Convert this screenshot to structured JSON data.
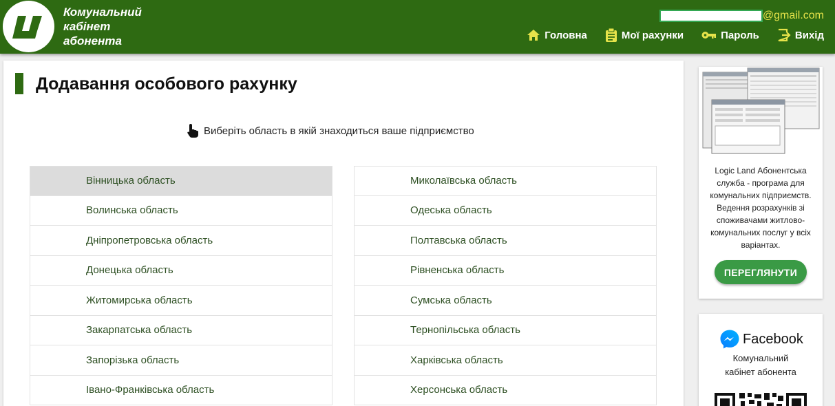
{
  "header": {
    "brand_line1": "Комунальний",
    "brand_line2": "кабінет",
    "brand_line3": "абонента",
    "email_domain": "@gmail.com",
    "nav": {
      "home": "Головна",
      "accounts": "Мої рахунки",
      "password": "Пароль",
      "logout": "Вихід"
    }
  },
  "main": {
    "title": "Додавання особового рахунку",
    "hint": "Виберіть область в якій знаходиться ваше підприємство",
    "regions_left": [
      "Вінницька область",
      "Волинська область",
      "Дніпропетровська область",
      "Донецька область",
      "Житомирська область",
      "Закарпатська область",
      "Запорізька область",
      "Івано-Франківська область"
    ],
    "regions_right": [
      "Миколаївська область",
      "Одеська область",
      "Полтавська область",
      "Рівненська область",
      "Сумська область",
      "Тернопільська область",
      "Харківська область",
      "Херсонська область"
    ]
  },
  "sidebar": {
    "ad_text": "Logic Land Абонентська служба - програма для комунальних підприємств. Ведення розрахунків зі споживачами житлово-комунальних послуг у всіх варіантах.",
    "ad_button": "ПЕРЕГЛЯНУТИ",
    "facebook_title": "Facebook",
    "facebook_sub_line1": "Комунальний",
    "facebook_sub_line2": "кабінет абонента"
  },
  "colors": {
    "header_green": "#2e6a12",
    "email_yellow": "#e6e34a",
    "button_green": "#3a9a45",
    "region_text": "#2d4f22",
    "active_row": "#dcdcdc"
  },
  "icons": [
    "home-icon",
    "clipboard-icon",
    "key-icon",
    "logout-icon",
    "hand-pointer-icon",
    "messenger-icon",
    "qr-code-icon"
  ]
}
